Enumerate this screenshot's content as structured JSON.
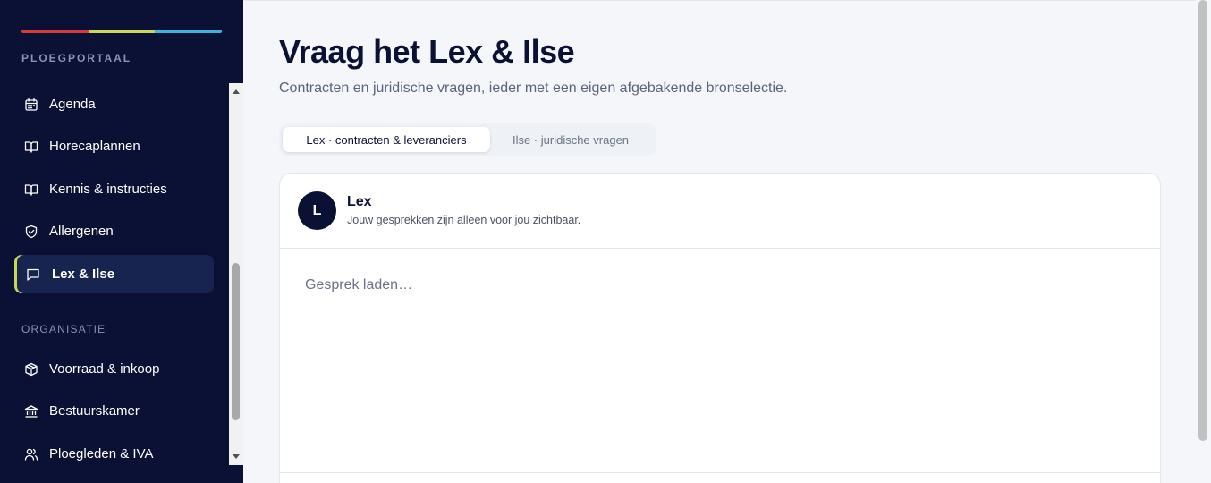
{
  "sidebar": {
    "brand_colors": [
      "#d63a3a",
      "#c9d65a",
      "#3fb3d9"
    ],
    "sections": [
      {
        "label": "PLOEGPORTAAL"
      },
      {
        "label": "ORGANISATIE"
      }
    ],
    "items": [
      {
        "label": "Agenda",
        "icon": "calendar-icon"
      },
      {
        "label": "Horecaplannen",
        "icon": "book-icon"
      },
      {
        "label": "Kennis & instructies",
        "icon": "book-icon"
      },
      {
        "label": "Allergenen",
        "icon": "shield-check-icon"
      },
      {
        "label": "Lex & Ilse",
        "icon": "message-icon",
        "active": true
      },
      {
        "label": "Voorraad & inkoop",
        "icon": "box-icon"
      },
      {
        "label": "Bestuurskamer",
        "icon": "bank-icon"
      },
      {
        "label": "Ploegleden & IVA",
        "icon": "users-icon"
      }
    ],
    "accent_color": "#c9d65a",
    "background_color": "#0b1134"
  },
  "main": {
    "title": "Vraag het Lex & Ilse",
    "subtitle": "Contracten en juridische vragen, ieder met een eigen afgebakende bronselectie.",
    "tabs": [
      {
        "label": "Lex · contracten & leveranciers",
        "active": true
      },
      {
        "label": "Ilse · juridische vragen",
        "active": false
      }
    ],
    "chat": {
      "avatar_initial": "L",
      "agent_name": "Lex",
      "privacy_note": "Jouw gesprekken zijn alleen voor jou zichtbaar.",
      "status": "Gesprek laden…"
    }
  }
}
